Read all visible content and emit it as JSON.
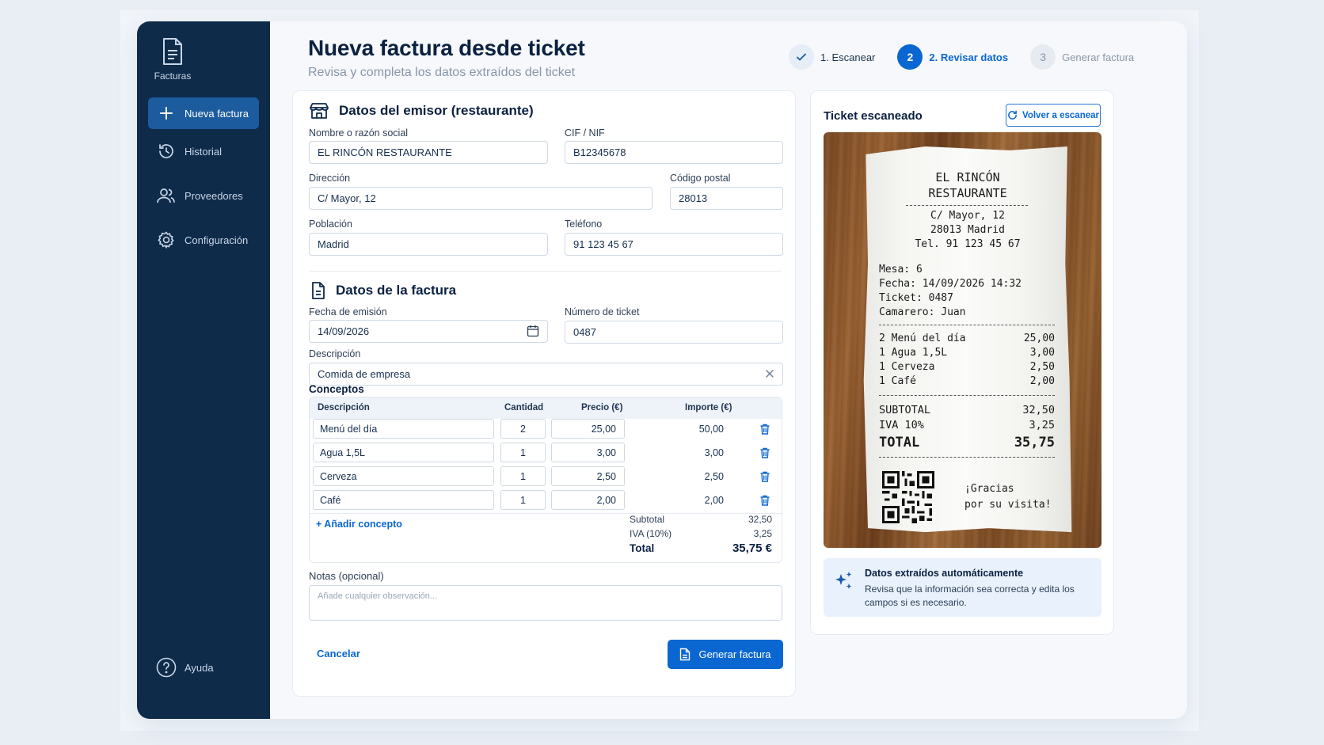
{
  "sidebar": {
    "brand_label": "Facturas",
    "items": [
      {
        "label": "Nueva factura",
        "icon": "plus-icon",
        "active": true
      },
      {
        "label": "Historial",
        "icon": "history-icon"
      },
      {
        "label": "Proveedores",
        "icon": "users-icon"
      },
      {
        "label": "Configuración",
        "icon": "gear-icon"
      }
    ],
    "help_label": "Ayuda"
  },
  "header": {
    "title": "Nueva factura desde ticket",
    "subtitle": "Revisa y completa los datos extraídos del ticket"
  },
  "stepper": {
    "steps": [
      {
        "number": "✓",
        "label": "1. Escanear",
        "state": "done"
      },
      {
        "number": "2",
        "label": "2. Revisar datos",
        "state": "active"
      },
      {
        "number": "3",
        "label": "Generar factura",
        "state": "todo"
      }
    ]
  },
  "emisor": {
    "heading": "Datos del emisor (restaurante)",
    "nombre_label": "Nombre o razón social",
    "nombre_value": "EL RINCÓN RESTAURANTE",
    "cif_label": "CIF / NIF",
    "cif_value": "B12345678",
    "direccion_label": "Dirección",
    "direccion_value": "C/ Mayor, 12",
    "cp_label": "Código postal",
    "cp_value": "28013",
    "poblacion_label": "Población",
    "poblacion_value": "Madrid",
    "telefono_label": "Teléfono",
    "telefono_value": "91 123 45 67"
  },
  "factura": {
    "heading": "Datos de la factura",
    "fecha_label": "Fecha de emisión",
    "fecha_value": "14/09/2026",
    "ticket_label": "Número de ticket",
    "ticket_value": "0487",
    "descripcion_label": "Descripción",
    "descripcion_value": "Comida de empresa"
  },
  "conceptos": {
    "heading": "Conceptos",
    "columns": [
      "Descripción",
      "Cantidad",
      "Precio (€)",
      "Importe (€)"
    ],
    "rows": [
      {
        "descripcion": "Menú del día",
        "cantidad": "2",
        "precio": "25,00",
        "importe": "50,00"
      },
      {
        "descripcion": "Agua 1,5L",
        "cantidad": "1",
        "precio": "3,00",
        "importe": "3,00"
      },
      {
        "descripcion": "Cerveza",
        "cantidad": "1",
        "precio": "2,50",
        "importe": "2,50"
      },
      {
        "descripcion": "Café",
        "cantidad": "1",
        "precio": "2,00",
        "importe": "2,00"
      }
    ],
    "add_label": "+ Añadir concepto",
    "subtotal_label": "Subtotal",
    "subtotal_value": "32,50",
    "iva_label": "IVA (10%)",
    "iva_value": "3,25",
    "total_label": "Total",
    "total_value": "35,75 €"
  },
  "notas": {
    "label": "Notas (opcional)",
    "placeholder": "Añade cualquier observación..."
  },
  "actions": {
    "cancel_label": "Cancelar",
    "generate_label": "Generar factura"
  },
  "ticket_panel": {
    "title": "Ticket escaneado",
    "rescan_label": "Volver a escanear",
    "receipt": {
      "name1": "EL RINCÓN",
      "name2": "RESTAURANTE",
      "addr1": "C/ Mayor, 12",
      "addr2": "28013 Madrid",
      "tel": "Tel. 91 123 45 67",
      "mesa": "Mesa: 6",
      "fecha": "Fecha: 14/09/2026 14:32",
      "ticket": "Ticket: 0487",
      "camarero": "Camarero: Juan",
      "items": [
        {
          "desc": "2 Menú del día",
          "amt": "25,00"
        },
        {
          "desc": "1 Agua 1,5L",
          "amt": "3,00"
        },
        {
          "desc": "1 Cerveza",
          "amt": "2,50"
        },
        {
          "desc": "1 Café",
          "amt": "2,00"
        }
      ],
      "subtotal_label": "SUBTOTAL",
      "subtotal": "32,50",
      "iva_label": "IVA 10%",
      "iva": "3,25",
      "total_label": "TOTAL",
      "total": "35,75",
      "thanks1": "¡Gracias",
      "thanks2": "por su visita!"
    },
    "info_heading": "Datos extraídos automáticamente",
    "info_text": "Revisa que la información sea correcta y edita los campos si es necesario."
  },
  "colors": {
    "sidebar_bg": "#0e2b4a",
    "accent": "#0a66d1",
    "active_nav": "#1c5b9e",
    "info_bg": "#e8f1fc"
  }
}
